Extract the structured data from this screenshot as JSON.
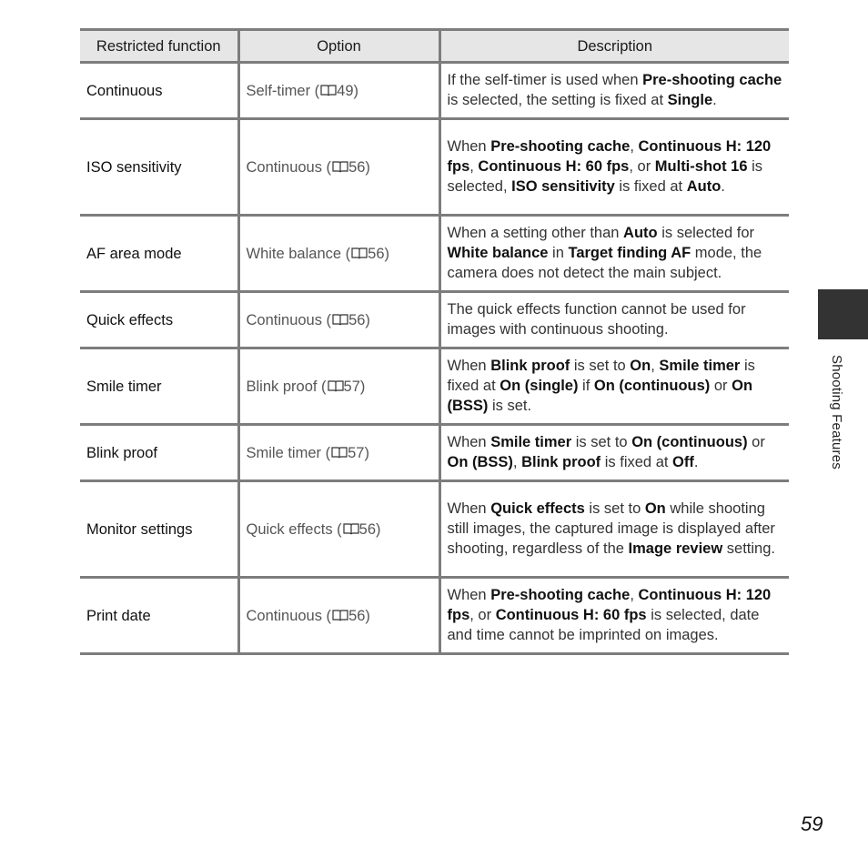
{
  "table": {
    "headers": [
      "Restricted function",
      "Option",
      "Description"
    ],
    "rows": [
      {
        "function": "Continuous",
        "option_label": "Self-timer (",
        "option_ref": "49)",
        "description": [
          {
            "t": "If the self-timer is used when "
          },
          {
            "b": "Pre-shooting cache"
          },
          {
            "t": " is selected, the setting is fixed at "
          },
          {
            "b": "Single"
          },
          {
            "t": "."
          }
        ]
      },
      {
        "function": "ISO sensitivity",
        "option_label": "Continuous (",
        "option_ref": "56)",
        "description": [
          {
            "t": "When "
          },
          {
            "b": "Pre-shooting cache"
          },
          {
            "t": ", "
          },
          {
            "b": "Continuous H: 120 fps"
          },
          {
            "t": ", "
          },
          {
            "b": "Continuous H: 60 fps"
          },
          {
            "t": ", or "
          },
          {
            "b": "Multi-shot 16"
          },
          {
            "t": " is selected, "
          },
          {
            "b": "ISO sensitivity"
          },
          {
            "t": " is fixed at "
          },
          {
            "b": "Auto"
          },
          {
            "t": "."
          }
        ]
      },
      {
        "function": "AF area mode",
        "option_label": "White balance (",
        "option_ref": "56)",
        "description": [
          {
            "t": "When a setting other than "
          },
          {
            "b": "Auto"
          },
          {
            "t": " is selected for "
          },
          {
            "b": "White balance"
          },
          {
            "t": " in "
          },
          {
            "b": "Target finding AF"
          },
          {
            "t": " mode, the camera does not detect the main subject."
          }
        ]
      },
      {
        "function": "Quick effects",
        "option_label": "Continuous (",
        "option_ref": "56)",
        "description": [
          {
            "t": "The quick effects function cannot be used for images with continuous shooting."
          }
        ]
      },
      {
        "function": "Smile timer",
        "option_label": "Blink proof (",
        "option_ref": "57)",
        "description": [
          {
            "t": "When "
          },
          {
            "b": "Blink proof"
          },
          {
            "t": " is set to "
          },
          {
            "b": "On"
          },
          {
            "t": ", "
          },
          {
            "b": "Smile timer"
          },
          {
            "t": " is fixed at "
          },
          {
            "b": "On (single)"
          },
          {
            "t": " if "
          },
          {
            "b": "On (continuous)"
          },
          {
            "t": " or "
          },
          {
            "b": "On (BSS)"
          },
          {
            "t": " is set."
          }
        ]
      },
      {
        "function": "Blink proof",
        "option_label": "Smile timer (",
        "option_ref": "57)",
        "description": [
          {
            "t": "When "
          },
          {
            "b": "Smile timer"
          },
          {
            "t": " is set to "
          },
          {
            "b": "On (continuous)"
          },
          {
            "t": " or "
          },
          {
            "b": "On (BSS)"
          },
          {
            "t": ", "
          },
          {
            "b": "Blink proof"
          },
          {
            "t": " is fixed at "
          },
          {
            "b": "Off"
          },
          {
            "t": "."
          }
        ]
      },
      {
        "function": "Monitor settings",
        "option_label": "Quick effects (",
        "option_ref": "56)",
        "description": [
          {
            "t": "When "
          },
          {
            "b": "Quick effects"
          },
          {
            "t": " is set to "
          },
          {
            "b": "On"
          },
          {
            "t": " while shooting still images, the captured image is displayed after shooting, regardless of the "
          },
          {
            "b": "Image review"
          },
          {
            "t": " setting."
          }
        ]
      },
      {
        "function": "Print date",
        "option_label": "Continuous (",
        "option_ref": "56)",
        "description": [
          {
            "t": "When "
          },
          {
            "b": "Pre-shooting cache"
          },
          {
            "t": ", "
          },
          {
            "b": "Continuous H: 120 fps"
          },
          {
            "t": ", or "
          },
          {
            "b": "Continuous H: 60 fps"
          },
          {
            "t": " is selected, date and time cannot be imprinted on images."
          }
        ]
      }
    ]
  },
  "icons": {
    "reference": "book-reference-icon"
  },
  "side_tab": {
    "label": "Shooting Features"
  },
  "page_number": "59"
}
